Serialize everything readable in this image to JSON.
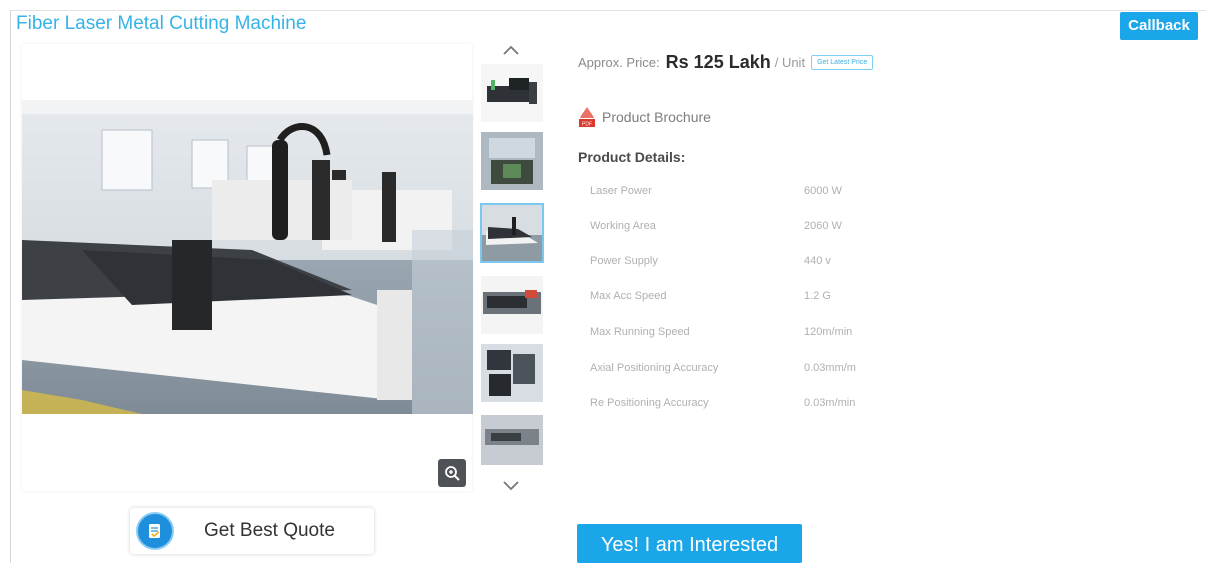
{
  "product": {
    "title": "Fiber Laser Metal Cutting Machine"
  },
  "header": {
    "callback_label": "Callback"
  },
  "price": {
    "prefix": "Approx. Price:",
    "value": "Rs 125 Lakh",
    "unit": "/ Unit",
    "latest_price_label": "Get Latest Price"
  },
  "brochure": {
    "label": "Product Brochure",
    "icon": "pdf-icon"
  },
  "details": {
    "heading": "Product Details:",
    "rows": [
      {
        "label": "Laser Power",
        "value": "6000 W"
      },
      {
        "label": "Working Area",
        "value": "2060 W"
      },
      {
        "label": "Power Supply",
        "value": "440 v"
      },
      {
        "label": "Max Acc Speed",
        "value": "1.2 G"
      },
      {
        "label": "Max Running Speed",
        "value": "120m/min"
      },
      {
        "label": "Axial Positioning Accuracy",
        "value": "0.03mm/m"
      },
      {
        "label": "Re Positioning Accuracy",
        "value": "0.03m/min"
      }
    ]
  },
  "gallery": {
    "thumbnail_count": 6,
    "active_thumbnail": 3
  },
  "actions": {
    "quote_label": "Get Best Quote",
    "interested_label": "Yes! I am Interested"
  },
  "colors": {
    "accent": "#1aa6e8",
    "title": "#36b3e6"
  }
}
